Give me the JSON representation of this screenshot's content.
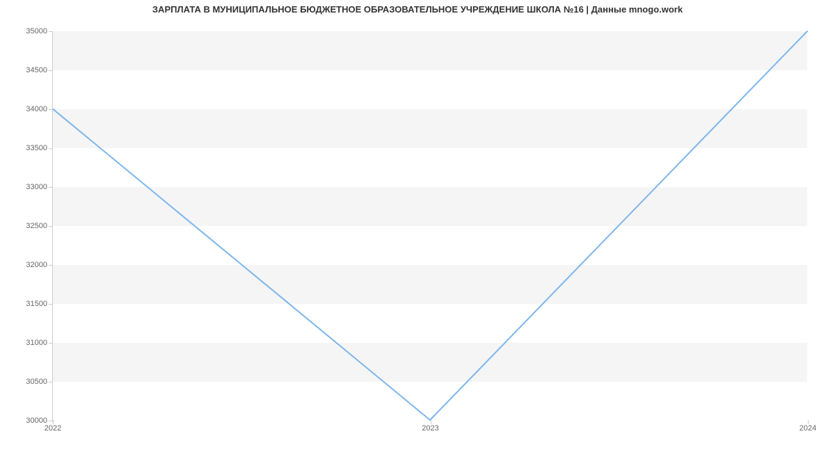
{
  "chart_data": {
    "type": "line",
    "title": "ЗАРПЛАТА В МУНИЦИПАЛЬНОЕ БЮДЖЕТНОЕ ОБРАЗОВАТЕЛЬНОЕ УЧРЕЖДЕНИЕ  ШКОЛА №16 | Данные mnogo.work",
    "x": [
      2022,
      2023,
      2024
    ],
    "values": [
      34000,
      30000,
      35000
    ],
    "xlabel": "",
    "ylabel": "",
    "ylim": [
      30000,
      35000
    ],
    "y_ticks": [
      30000,
      30500,
      31000,
      31500,
      32000,
      32500,
      33000,
      33500,
      34000,
      34500,
      35000
    ],
    "x_ticks": [
      2022,
      2023,
      2024
    ],
    "grid": true,
    "series_color": "#7cb5ec"
  }
}
